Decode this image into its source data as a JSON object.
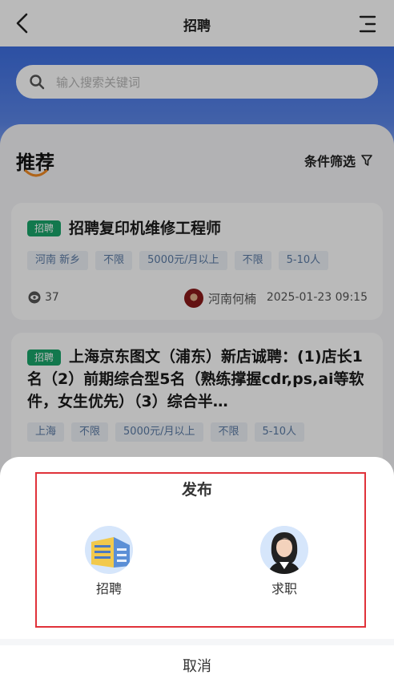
{
  "nav": {
    "title": "招聘",
    "back_icon": "back-arrow-icon",
    "menu_icon": "menu-icon"
  },
  "search": {
    "placeholder": "输入搜索关键词"
  },
  "section": {
    "title": "推荐",
    "filter_label": "条件筛选"
  },
  "jobs": [
    {
      "badge": "招聘",
      "title": "招聘复印机维修工程师",
      "chips": [
        "河南 新乡",
        "不限",
        "5000元/月以上",
        "不限",
        "5-10人"
      ],
      "views": "37",
      "author": "河南何楠",
      "time": "2025-01-23 09:15"
    },
    {
      "badge": "招聘",
      "title": "上海京东图文（浦东）新店诚聘：(1)店长1名（2）前期综合型5名（熟练撑握cdr,ps,ai等软件，女生优先）（3）综合半…",
      "chips": [
        "上海",
        "不限",
        "5000元/月以上",
        "不限",
        "5-10人"
      ]
    }
  ],
  "sheet": {
    "title": "发布",
    "options": [
      {
        "label": "招聘",
        "icon": "building-icon"
      },
      {
        "label": "求职",
        "icon": "woman-avatar-icon"
      }
    ],
    "cancel": "取消"
  },
  "colors": {
    "accent": "#3d6ee0",
    "badge": "#1aa56a",
    "highlight_frame": "#e0323a"
  }
}
